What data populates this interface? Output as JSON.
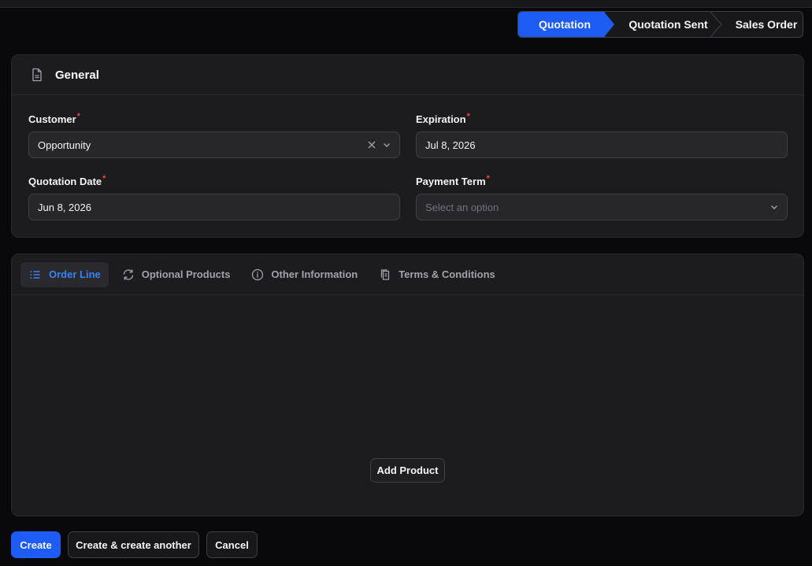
{
  "stepper": {
    "steps": [
      "Quotation",
      "Quotation Sent",
      "Sales Order"
    ],
    "active_color": "#1d5df5"
  },
  "general": {
    "title": "General",
    "icon": "document-icon",
    "fields": {
      "customer": {
        "label": "Customer",
        "required": "*",
        "value": "Opportunity"
      },
      "expiration": {
        "label": "Expiration",
        "required": "*",
        "value": "Jul 8, 2026"
      },
      "quotation_date": {
        "label": "Quotation Date",
        "required": "*",
        "value": "Jun 8, 2026"
      },
      "payment_term": {
        "label": "Payment Term",
        "required": "*",
        "placeholder": "Select an option"
      }
    }
  },
  "tabs": {
    "items": [
      {
        "label": "Order Line",
        "icon": "list-icon",
        "active": true
      },
      {
        "label": "Optional Products",
        "icon": "refresh-icon",
        "active": false
      },
      {
        "label": "Other Information",
        "icon": "info-icon",
        "active": false
      },
      {
        "label": "Terms & Conditions",
        "icon": "copy-icon",
        "active": false
      }
    ],
    "add_product_label": "Add Product"
  },
  "actions": {
    "create": "Create",
    "create_another": "Create & create another",
    "cancel": "Cancel"
  },
  "colors": {
    "primary": "#1d5df5",
    "background": "#09090b",
    "card": "#1c1c1f",
    "required": "#ef4444",
    "active_tab": "#3b82f6"
  }
}
